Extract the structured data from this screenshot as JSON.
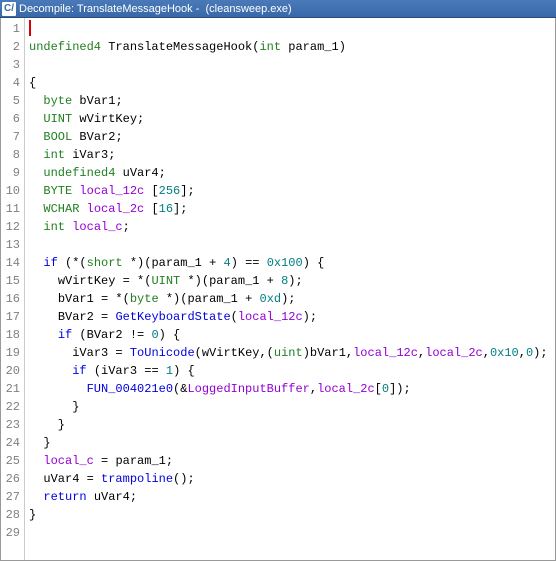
{
  "titlebar": {
    "icon_text": "C/",
    "prefix": "Decompile: ",
    "func": "TranslateMessageHook",
    "suffix": " -  (cleansweep.exe)"
  },
  "lines": [
    {
      "n": 1,
      "seg": [
        {
          "t": "cursor"
        }
      ]
    },
    {
      "n": 2,
      "seg": [
        {
          "c": "ty",
          "t": "undefined4 "
        },
        {
          "c": "fn",
          "t": "TranslateMessageHook"
        },
        {
          "c": "pun",
          "t": "("
        },
        {
          "c": "ty",
          "t": "int "
        },
        {
          "c": "id",
          "t": "param_1"
        },
        {
          "c": "pun",
          "t": ")"
        }
      ]
    },
    {
      "n": 3,
      "seg": []
    },
    {
      "n": 4,
      "seg": [
        {
          "c": "pun",
          "t": "{"
        }
      ]
    },
    {
      "n": 5,
      "seg": [
        {
          "c": "pun",
          "t": "  "
        },
        {
          "c": "ty",
          "t": "byte "
        },
        {
          "c": "id",
          "t": "bVar1"
        },
        {
          "c": "pun",
          "t": ";"
        }
      ]
    },
    {
      "n": 6,
      "seg": [
        {
          "c": "pun",
          "t": "  "
        },
        {
          "c": "ty",
          "t": "UINT "
        },
        {
          "c": "id",
          "t": "wVirtKey"
        },
        {
          "c": "pun",
          "t": ";"
        }
      ]
    },
    {
      "n": 7,
      "seg": [
        {
          "c": "pun",
          "t": "  "
        },
        {
          "c": "ty",
          "t": "BOOL "
        },
        {
          "c": "id",
          "t": "BVar2"
        },
        {
          "c": "pun",
          "t": ";"
        }
      ]
    },
    {
      "n": 8,
      "seg": [
        {
          "c": "pun",
          "t": "  "
        },
        {
          "c": "ty",
          "t": "int "
        },
        {
          "c": "id",
          "t": "iVar3"
        },
        {
          "c": "pun",
          "t": ";"
        }
      ]
    },
    {
      "n": 9,
      "seg": [
        {
          "c": "pun",
          "t": "  "
        },
        {
          "c": "ty",
          "t": "undefined4 "
        },
        {
          "c": "id",
          "t": "uVar4"
        },
        {
          "c": "pun",
          "t": ";"
        }
      ]
    },
    {
      "n": 10,
      "seg": [
        {
          "c": "pun",
          "t": "  "
        },
        {
          "c": "ty",
          "t": "BYTE "
        },
        {
          "c": "gl",
          "t": "local_12c "
        },
        {
          "c": "pun",
          "t": "["
        },
        {
          "c": "num",
          "t": "256"
        },
        {
          "c": "pun",
          "t": "];"
        }
      ]
    },
    {
      "n": 11,
      "seg": [
        {
          "c": "pun",
          "t": "  "
        },
        {
          "c": "ty",
          "t": "WCHAR "
        },
        {
          "c": "gl",
          "t": "local_2c "
        },
        {
          "c": "pun",
          "t": "["
        },
        {
          "c": "num",
          "t": "16"
        },
        {
          "c": "pun",
          "t": "];"
        }
      ]
    },
    {
      "n": 12,
      "seg": [
        {
          "c": "pun",
          "t": "  "
        },
        {
          "c": "ty",
          "t": "int "
        },
        {
          "c": "gl",
          "t": "local_c"
        },
        {
          "c": "pun",
          "t": ";"
        }
      ]
    },
    {
      "n": 13,
      "seg": [
        {
          "c": "pun",
          "t": "  "
        }
      ]
    },
    {
      "n": 14,
      "seg": [
        {
          "c": "pun",
          "t": "  "
        },
        {
          "c": "kw",
          "t": "if "
        },
        {
          "c": "pun",
          "t": "(*("
        },
        {
          "c": "ty",
          "t": "short "
        },
        {
          "c": "pun",
          "t": "*)("
        },
        {
          "c": "id",
          "t": "param_1"
        },
        {
          "c": "pun",
          "t": " + "
        },
        {
          "c": "num",
          "t": "4"
        },
        {
          "c": "pun",
          "t": ") == "
        },
        {
          "c": "num",
          "t": "0x100"
        },
        {
          "c": "pun",
          "t": ") {"
        }
      ]
    },
    {
      "n": 15,
      "seg": [
        {
          "c": "pun",
          "t": "    "
        },
        {
          "c": "id",
          "t": "wVirtKey"
        },
        {
          "c": "pun",
          "t": " = *("
        },
        {
          "c": "ty",
          "t": "UINT "
        },
        {
          "c": "pun",
          "t": "*)("
        },
        {
          "c": "id",
          "t": "param_1"
        },
        {
          "c": "pun",
          "t": " + "
        },
        {
          "c": "num",
          "t": "8"
        },
        {
          "c": "pun",
          "t": ");"
        }
      ]
    },
    {
      "n": 16,
      "seg": [
        {
          "c": "pun",
          "t": "    "
        },
        {
          "c": "id",
          "t": "bVar1"
        },
        {
          "c": "pun",
          "t": " = *("
        },
        {
          "c": "ty",
          "t": "byte "
        },
        {
          "c": "pun",
          "t": "*)("
        },
        {
          "c": "id",
          "t": "param_1"
        },
        {
          "c": "pun",
          "t": " + "
        },
        {
          "c": "num",
          "t": "0xd"
        },
        {
          "c": "pun",
          "t": ");"
        }
      ]
    },
    {
      "n": 17,
      "seg": [
        {
          "c": "pun",
          "t": "    "
        },
        {
          "c": "id",
          "t": "BVar2"
        },
        {
          "c": "pun",
          "t": " = "
        },
        {
          "c": "gf",
          "t": "GetKeyboardState"
        },
        {
          "c": "pun",
          "t": "("
        },
        {
          "c": "gl",
          "t": "local_12c"
        },
        {
          "c": "pun",
          "t": ");"
        }
      ]
    },
    {
      "n": 18,
      "seg": [
        {
          "c": "pun",
          "t": "    "
        },
        {
          "c": "kw",
          "t": "if "
        },
        {
          "c": "pun",
          "t": "("
        },
        {
          "c": "id",
          "t": "BVar2"
        },
        {
          "c": "pun",
          "t": " != "
        },
        {
          "c": "num",
          "t": "0"
        },
        {
          "c": "pun",
          "t": ") {"
        }
      ]
    },
    {
      "n": 19,
      "seg": [
        {
          "c": "pun",
          "t": "      "
        },
        {
          "c": "id",
          "t": "iVar3"
        },
        {
          "c": "pun",
          "t": " = "
        },
        {
          "c": "gf",
          "t": "ToUnicode"
        },
        {
          "c": "pun",
          "t": "("
        },
        {
          "c": "id",
          "t": "wVirtKey"
        },
        {
          "c": "pun",
          "t": ",("
        },
        {
          "c": "ty",
          "t": "uint"
        },
        {
          "c": "pun",
          "t": ")"
        },
        {
          "c": "id",
          "t": "bVar1"
        },
        {
          "c": "pun",
          "t": ","
        },
        {
          "c": "gl",
          "t": "local_12c"
        },
        {
          "c": "pun",
          "t": ","
        },
        {
          "c": "gl",
          "t": "local_2c"
        },
        {
          "c": "pun",
          "t": ","
        },
        {
          "c": "num",
          "t": "0x10"
        },
        {
          "c": "pun",
          "t": ","
        },
        {
          "c": "num",
          "t": "0"
        },
        {
          "c": "pun",
          "t": ");"
        }
      ]
    },
    {
      "n": 20,
      "seg": [
        {
          "c": "pun",
          "t": "      "
        },
        {
          "c": "kw",
          "t": "if "
        },
        {
          "c": "pun",
          "t": "("
        },
        {
          "c": "id",
          "t": "iVar3"
        },
        {
          "c": "pun",
          "t": " == "
        },
        {
          "c": "num",
          "t": "1"
        },
        {
          "c": "pun",
          "t": ") {"
        }
      ]
    },
    {
      "n": 21,
      "seg": [
        {
          "c": "pun",
          "t": "        "
        },
        {
          "c": "gf",
          "t": "FUN_004021e0"
        },
        {
          "c": "pun",
          "t": "(&"
        },
        {
          "c": "gl",
          "t": "LoggedInputBuffer"
        },
        {
          "c": "pun",
          "t": ","
        },
        {
          "c": "gl",
          "t": "local_2c"
        },
        {
          "c": "pun",
          "t": "["
        },
        {
          "c": "num",
          "t": "0"
        },
        {
          "c": "pun",
          "t": "]);"
        }
      ]
    },
    {
      "n": 22,
      "seg": [
        {
          "c": "pun",
          "t": "      }"
        }
      ]
    },
    {
      "n": 23,
      "seg": [
        {
          "c": "pun",
          "t": "    }"
        }
      ]
    },
    {
      "n": 24,
      "seg": [
        {
          "c": "pun",
          "t": "  }"
        }
      ]
    },
    {
      "n": 25,
      "seg": [
        {
          "c": "pun",
          "t": "  "
        },
        {
          "c": "gl",
          "t": "local_c"
        },
        {
          "c": "pun",
          "t": " = "
        },
        {
          "c": "id",
          "t": "param_1"
        },
        {
          "c": "pun",
          "t": ";"
        }
      ]
    },
    {
      "n": 26,
      "seg": [
        {
          "c": "pun",
          "t": "  "
        },
        {
          "c": "id",
          "t": "uVar4"
        },
        {
          "c": "pun",
          "t": " = "
        },
        {
          "c": "gf",
          "t": "trampoline"
        },
        {
          "c": "pun",
          "t": "();"
        }
      ]
    },
    {
      "n": 27,
      "seg": [
        {
          "c": "pun",
          "t": "  "
        },
        {
          "c": "kw",
          "t": "return "
        },
        {
          "c": "id",
          "t": "uVar4"
        },
        {
          "c": "pun",
          "t": ";"
        }
      ]
    },
    {
      "n": 28,
      "seg": [
        {
          "c": "pun",
          "t": "}"
        }
      ]
    },
    {
      "n": 29,
      "seg": []
    }
  ]
}
